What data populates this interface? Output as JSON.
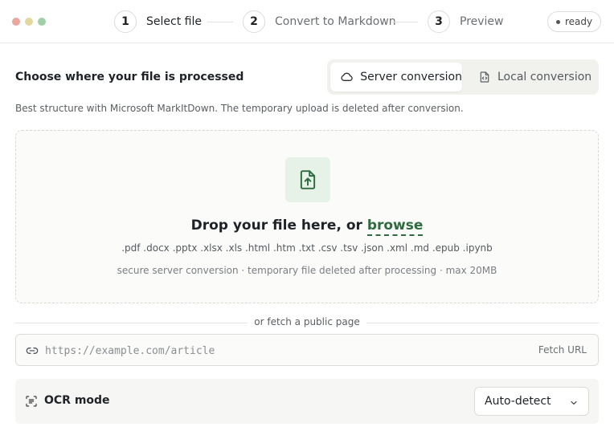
{
  "window": {
    "controls": [
      "close",
      "minimize",
      "maximize"
    ]
  },
  "steps": [
    {
      "number": "1",
      "label": "Select file",
      "active": true
    },
    {
      "number": "2",
      "label": "Convert to Markdown",
      "active": false
    },
    {
      "number": "3",
      "label": "Preview",
      "active": false
    }
  ],
  "status": {
    "label": "ready"
  },
  "processing": {
    "title": "Choose where your file is processed",
    "options": [
      {
        "label": "Server conversion",
        "icon": "cloud-icon",
        "selected": true
      },
      {
        "label": "Local conversion",
        "icon": "file-code-icon",
        "selected": false
      }
    ],
    "description": "Best structure with Microsoft MarkItDown. The temporary upload is deleted after conversion."
  },
  "dropzone": {
    "icon": "file-upload-icon",
    "headline_prefix": "Drop your file here, or ",
    "browse_label": "browse",
    "formats": ".pdf .docx .pptx .xlsx .xls .html .htm .txt .csv .tsv .json .xml .md .epub .ipynb",
    "note": "secure server conversion · temporary file deleted after processing · max 20MB"
  },
  "fetch": {
    "divider_label": "or fetch a public page",
    "placeholder": "https://example.com/article",
    "value": "",
    "button_label": "Fetch URL"
  },
  "ocr": {
    "label": "OCR mode",
    "selected": "Auto-detect"
  },
  "colors": {
    "accent": "#2e6b3f",
    "accent_bg": "#e6f1e8",
    "dot_red": "#e8a89e",
    "dot_yellow": "#e3d89e",
    "dot_green": "#9fd0a7"
  }
}
